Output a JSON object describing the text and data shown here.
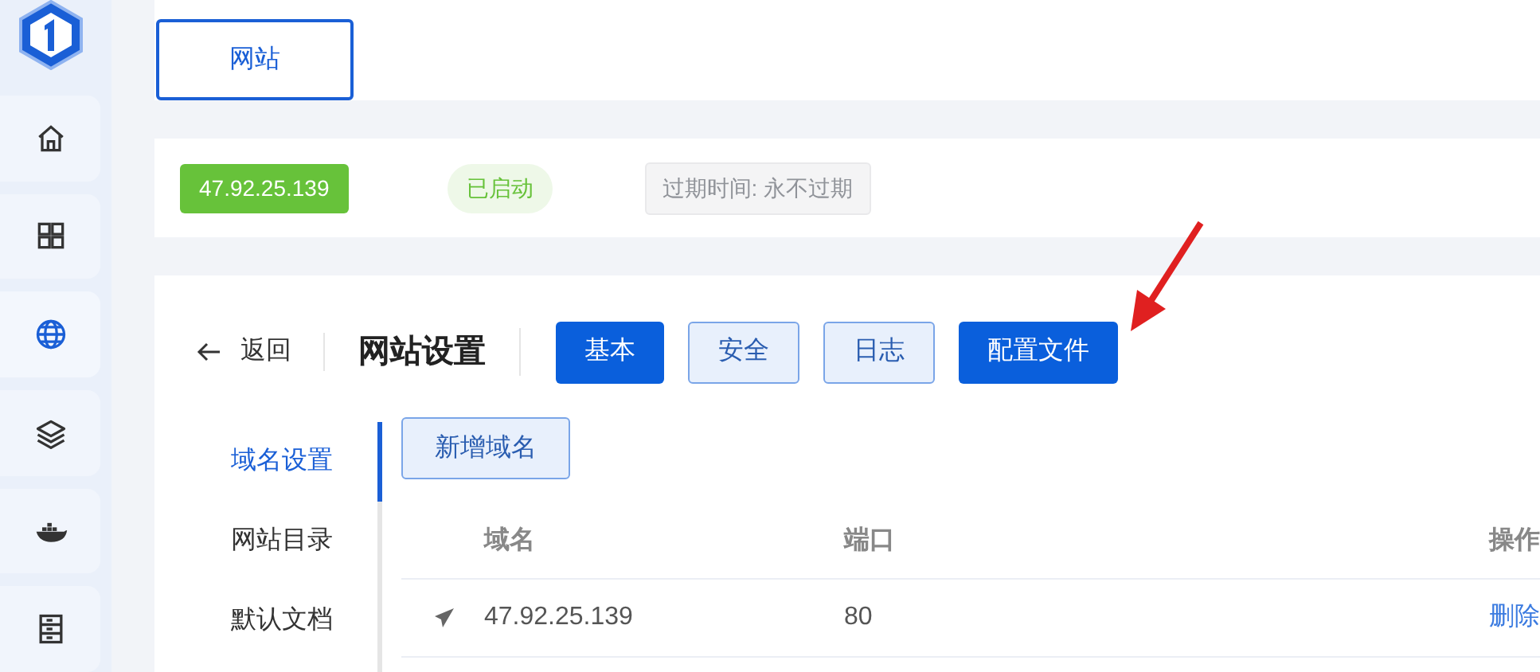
{
  "sidebar": {
    "items": [
      {
        "kind": "home",
        "selected": false
      },
      {
        "kind": "apps",
        "selected": false
      },
      {
        "kind": "globe",
        "selected": true
      },
      {
        "kind": "layers",
        "selected": false
      },
      {
        "kind": "container",
        "selected": false
      },
      {
        "kind": "server",
        "selected": false
      }
    ]
  },
  "top_tabs": [
    {
      "label": "网站",
      "selected": true
    }
  ],
  "site_info": {
    "ip": "47.92.25.139",
    "status": "已启动",
    "expiry": "过期时间: 永不过期"
  },
  "header": {
    "back": "返回",
    "title": "网站设置",
    "tabs": [
      {
        "label": "基本",
        "selected": true
      },
      {
        "label": "安全",
        "selected": false
      },
      {
        "label": "日志",
        "selected": false
      },
      {
        "label": "配置文件",
        "selected": true
      }
    ]
  },
  "side_menu": [
    {
      "label": "域名设置",
      "selected": true
    },
    {
      "label": "网站目录",
      "selected": false
    },
    {
      "label": "默认文档",
      "selected": false
    }
  ],
  "add_button": "新增域名",
  "table": {
    "columns": [
      "域名",
      "端口",
      "操作"
    ],
    "rows": [
      {
        "domain": "47.92.25.139",
        "port": "80",
        "action": "删除"
      }
    ]
  }
}
